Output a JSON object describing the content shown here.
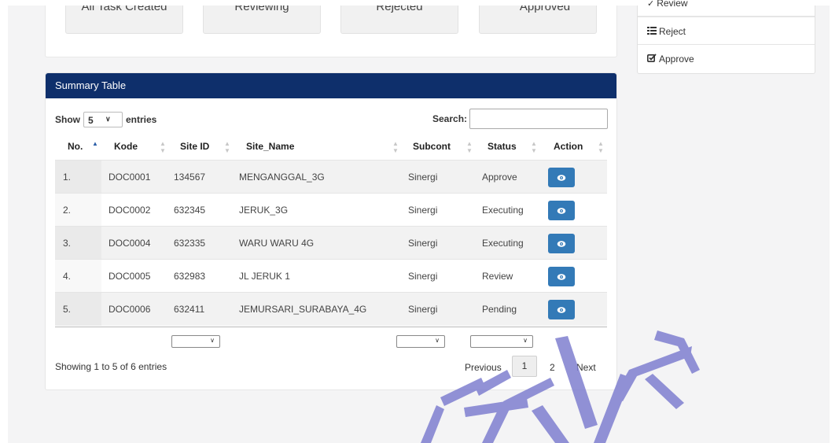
{
  "status_cards": [
    {
      "label": "All Task Created"
    },
    {
      "label": "Reviewing"
    },
    {
      "label": "Rejected"
    },
    {
      "label": "Approved"
    }
  ],
  "side_menu": {
    "items": [
      {
        "label": "Review",
        "icon": "check-icon"
      },
      {
        "label": "Reject",
        "icon": "list-icon"
      },
      {
        "label": "Approve",
        "icon": "check-square-icon"
      }
    ]
  },
  "table": {
    "header_title": "Summary Table",
    "length": {
      "show_label": "Show",
      "value": "5",
      "entries_label": "entries"
    },
    "search": {
      "label": "Search:",
      "value": ""
    },
    "columns": [
      "No.",
      "Kode",
      "Site ID",
      "Site_Name",
      "Subcont",
      "Status",
      "Action"
    ],
    "sorted_column": "No.",
    "rows": [
      {
        "no": "1.",
        "kode": "DOC0001",
        "site_id": "134567",
        "site_name": "MENGANGGAL_3G",
        "subcont": "Sinergi",
        "status": "Approve"
      },
      {
        "no": "2.",
        "kode": "DOC0002",
        "site_id": "632345",
        "site_name": "JERUK_3G",
        "subcont": "Sinergi",
        "status": "Executing"
      },
      {
        "no": "3.",
        "kode": "DOC0004",
        "site_id": "632335",
        "site_name": "WARU WARU 4G",
        "subcont": "Sinergi",
        "status": "Executing"
      },
      {
        "no": "4.",
        "kode": "DOC0005",
        "site_id": "632983",
        "site_name": "JL JERUK 1",
        "subcont": "Sinergi",
        "status": "Review"
      },
      {
        "no": "5.",
        "kode": "DOC0006",
        "site_id": "632411",
        "site_name": "JEMURSARI_SURABAYA_4G",
        "subcont": "Sinergi",
        "status": "Pending"
      }
    ],
    "action_icon": "eye-icon",
    "info": "Showing 1 to 5 of 6 entries",
    "pagination": {
      "previous": "Previous",
      "pages": [
        "1",
        "2"
      ],
      "current": "1",
      "next": "Next"
    }
  },
  "colors": {
    "header_bg": "#0e2f6b",
    "action_button": "#337ab7",
    "page_bg": "#f4f4f5",
    "watermark": "#7f7fd0"
  },
  "watermark_text": "TEKNIKA"
}
